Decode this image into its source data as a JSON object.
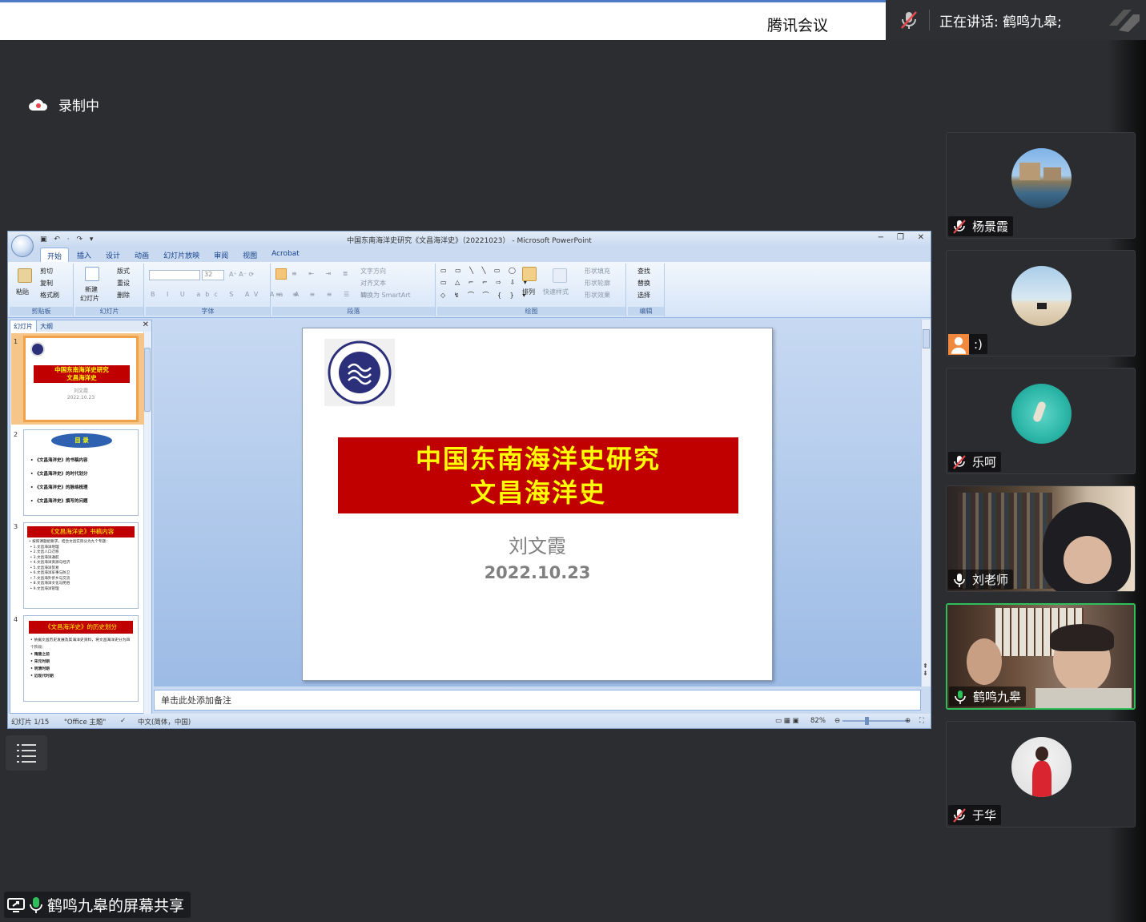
{
  "window": {
    "app_title": "腾讯会议",
    "speaking_label": "正在讲话: 鹤鸣九皋;"
  },
  "recording": {
    "label": "录制中"
  },
  "share": {
    "label": "鹤鸣九皋的屏幕共享"
  },
  "participants": [
    {
      "name": "杨景霞",
      "mic": "muted"
    },
    {
      "name": ":)",
      "mic": "none"
    },
    {
      "name": "乐呵",
      "mic": "muted"
    },
    {
      "name": "刘老师",
      "mic": "on"
    },
    {
      "name": "鹤鸣九皋",
      "mic": "active"
    },
    {
      "name": "于华",
      "mic": "muted"
    }
  ],
  "ppt": {
    "title": "中国东南海洋史研究《文昌海洋史》（20221023） - Microsoft PowerPoint",
    "tabs": [
      "开始",
      "插入",
      "设计",
      "动画",
      "幻灯片放映",
      "审阅",
      "视图",
      "Acrobat"
    ],
    "ribbon": {
      "paste": "粘贴",
      "cut": "剪切",
      "copy": "复制",
      "format_painter": "格式刷",
      "new_slide_1": "新建",
      "new_slide_2": "幻灯片",
      "layout": "版式",
      "reset": "重设",
      "delete": "删除",
      "font_size": "32",
      "text_direction": "文字方向",
      "align_text": "对齐文本",
      "smartart": "转换为 SmartArt",
      "arrange": "排列",
      "quick_styles": "快速样式",
      "shape_fill": "形状填充",
      "shape_outline": "形状轮廓",
      "shape_effects": "形状效果",
      "find": "查找",
      "replace": "替换",
      "select": "选择",
      "groups": {
        "clipboard": "剪贴板",
        "slides": "幻灯片",
        "font": "字体",
        "paragraph": "段落",
        "drawing": "绘图",
        "editing": "编辑"
      }
    },
    "panel_tabs": [
      "幻灯片",
      "大纲"
    ],
    "thumbnails": {
      "t1_num": "1",
      "t1_title1": "中国东南海洋史研究",
      "t1_title2": "文昌海洋史",
      "t1_author": "刘文霞",
      "t1_date": "2022.10.23",
      "t2_num": "2",
      "t2_heading": "目 录",
      "t2_items": [
        "《文昌海洋史》的书稿内容",
        "《文昌海洋史》的时代划分",
        "《文昌海洋史》的脉络梳理",
        "《文昌海洋史》撰写的问题"
      ],
      "t3_num": "3",
      "t3_heading": "《文昌海洋史》书稿内容",
      "t3_intro": "按照课题组要求，结合文昌实际分为九个专题：",
      "t3_items": [
        "1.文昌海洋地理",
        "2.文昌人口迁移",
        "3.文昌海洋通航",
        "4.文昌海洋资源与经济",
        "5.文昌海洋贸易",
        "6.文昌海洋军事与防卫",
        "7.文昌海外侨乡与交流",
        "8.文昌海洋文化与民俗",
        "9.文昌海洋管理"
      ],
      "t4_num": "4",
      "t4_heading": "《文昌海洋史》的历史划分",
      "t4_intro": "依据文昌历史发展及其海洋史资料，将文昌海洋史分为四个阶段：",
      "t4_items": [
        "隋唐之前",
        "宋元时期",
        "明清时期",
        "近现代时期"
      ]
    },
    "slide": {
      "title_line1": "中国东南海洋史研究",
      "title_line2": "文昌海洋史",
      "author": "刘文霞",
      "date": "2022.10.23"
    },
    "notes_placeholder": "单击此处添加备注",
    "status": {
      "slide_counter": "幻灯片 1/15",
      "theme": "\"Office 主题\"",
      "language": "中文(简体，中国)",
      "zoom": "82%"
    }
  },
  "colors": {
    "title_box": "#c00000",
    "title_text": "#ffff00",
    "active_speaker_border": "#2fbf5a",
    "muted_icon": "#e5484d",
    "mic_on": "#2fbf5a"
  }
}
